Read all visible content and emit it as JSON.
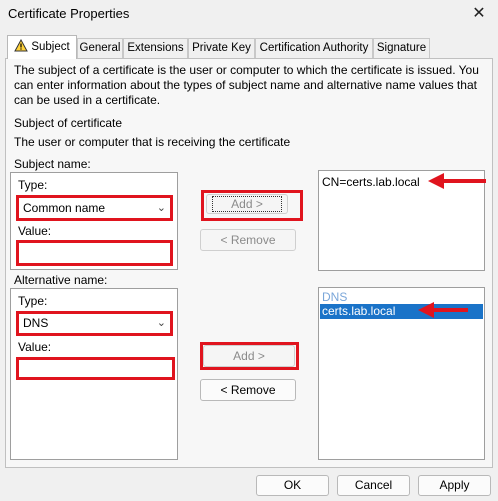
{
  "window": {
    "title": "Certificate Properties",
    "close_glyph": "✕"
  },
  "tabs": [
    {
      "label": "Subject",
      "active": true
    },
    {
      "label": "General"
    },
    {
      "label": "Extensions"
    },
    {
      "label": "Private Key"
    },
    {
      "label": "Certification Authority"
    },
    {
      "label": "Signature"
    }
  ],
  "intro_text": "The subject of a certificate is the user or computer to which the certificate is issued. You can enter information about the types of subject name and alternative name values that can be used in a certificate.",
  "subject_of_certificate": {
    "heading": "Subject of certificate",
    "description": "The user or computer that is receiving the certificate"
  },
  "subject_name": {
    "label": "Subject name:",
    "type_label": "Type:",
    "type_value": "Common name",
    "value_label": "Value:",
    "value_text": "",
    "add_label": "Add >",
    "remove_label": "< Remove",
    "list": [
      "CN=certs.lab.local"
    ]
  },
  "alternative_name": {
    "label": "Alternative name:",
    "type_label": "Type:",
    "type_value": "DNS",
    "value_label": "Value:",
    "value_text": "",
    "add_label": "Add >",
    "remove_label": "< Remove",
    "list_header": "DNS",
    "list": [
      "certs.lab.local"
    ]
  },
  "footer": {
    "ok_label": "OK",
    "cancel_label": "Cancel",
    "apply_label": "Apply"
  },
  "colors": {
    "annotation_red": "#e0141e",
    "selection_blue": "#1a73c8"
  }
}
